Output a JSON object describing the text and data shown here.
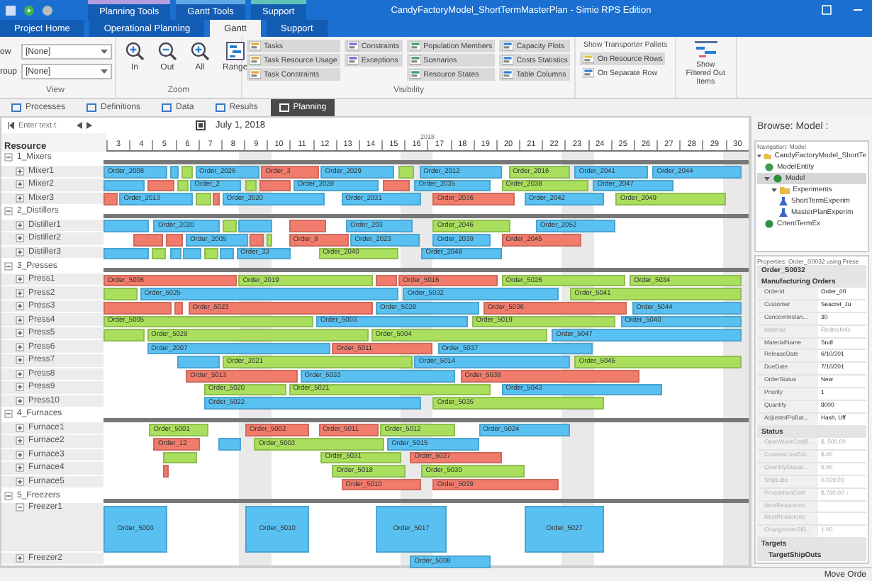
{
  "window": {
    "title": "CandyFactoryModel_ShortTermMasterPlan - Simio RPS Edition",
    "context_tabs": [
      {
        "label": "Planning Tools",
        "color": "#b59be0"
      },
      {
        "label": "Gantt Tools",
        "color": "#5fa8e6"
      },
      {
        "label": "Support",
        "color": "#62c3b8"
      }
    ]
  },
  "ribbon_tabs": [
    {
      "label": "Project Home",
      "selected": false
    },
    {
      "label": "Operational Planning",
      "selected": false
    },
    {
      "label": "Gantt",
      "selected": true
    },
    {
      "label": "Support",
      "selected": false
    }
  ],
  "view_group": {
    "label": "View",
    "fields": [
      {
        "label": "ow",
        "value": "[None]"
      },
      {
        "label": "roup",
        "value": "[None]"
      }
    ]
  },
  "zoom_group": {
    "label": "Zoom",
    "buttons": [
      {
        "label": "In",
        "kind": "in"
      },
      {
        "label": "Out",
        "kind": "out"
      },
      {
        "label": "All",
        "kind": "all"
      },
      {
        "label": "Range",
        "kind": "range"
      }
    ]
  },
  "visibility_group": {
    "label": "Visibility",
    "columns": [
      [
        {
          "label": "Tasks",
          "on": true
        },
        {
          "label": "Task Resource Usage",
          "on": true
        },
        {
          "label": "Task Constraints",
          "on": true
        }
      ],
      [
        {
          "label": "Constraints",
          "on": true
        },
        {
          "label": "Exceptions",
          "on": true
        }
      ],
      [
        {
          "label": "Population Members",
          "on": true
        },
        {
          "label": "Scenarios",
          "on": true
        },
        {
          "label": "Resource States",
          "on": true
        }
      ],
      [
        {
          "label": "Capacity Plots",
          "on": true
        },
        {
          "label": "Costs Statistics",
          "on": true
        },
        {
          "label": "Table Columns",
          "on": true
        }
      ]
    ]
  },
  "pallets": {
    "label": "Show Transporter Pallets",
    "options": [
      {
        "label": "On Resource Rows",
        "selected": true
      },
      {
        "label": "On Separate Row",
        "selected": false
      }
    ]
  },
  "filtered_button": {
    "label": "Show Filtered Out Items"
  },
  "section_tabs": [
    {
      "label": "Processes",
      "selected": false
    },
    {
      "label": "Definitions",
      "selected": false
    },
    {
      "label": "Data",
      "selected": false
    },
    {
      "label": "Results",
      "selected": false
    },
    {
      "label": "Planning",
      "selected": true
    }
  ],
  "gantt": {
    "search": {
      "placeholder": "Enter text t"
    },
    "date": "July 1, 2018",
    "year": "2018",
    "resource_header": "Resource",
    "days": [
      "3",
      "4",
      "5",
      "6",
      "7",
      "8",
      "9",
      "10",
      "11",
      "12",
      "13",
      "14",
      "15",
      "16",
      "17",
      "18",
      "19",
      "20",
      "21",
      "22",
      "23",
      "24",
      "25",
      "26",
      "27",
      "28",
      "29",
      "30"
    ],
    "rows": [
      {
        "name": "1_Mixers",
        "kind": "group",
        "expanded": true
      },
      {
        "name": "Mixer1",
        "kind": "resource",
        "expanded": false,
        "bars": [
          {
            "color": "#59c1f2",
            "label": "Order_2008"
          },
          {
            "color": "#59c1f2"
          },
          {
            "color": "#a9df5d"
          },
          {
            "color": "#59c1f2",
            "label": "Order_2026"
          },
          {
            "color": "#f27c6c",
            "label": "Order_3"
          },
          {
            "color": "#59c1f2",
            "label": "Order_2029"
          },
          {
            "color": "#a9df5d"
          },
          {
            "color": "#59c1f2",
            "label": "Order_2012"
          },
          {
            "color": "#a9df5d",
            "label": "Order_2016"
          },
          {
            "color": "#59c1f2",
            "label": "Order_2041"
          },
          {
            "color": "#59c1f2",
            "label": "Order_2044"
          }
        ]
      },
      {
        "name": "Mixer2",
        "kind": "resource",
        "expanded": false,
        "bars": [
          {
            "color": "#59c1f2"
          },
          {
            "color": "#f27c6c"
          },
          {
            "color": "#a9df5d"
          },
          {
            "color": "#59c1f2",
            "label": "Order_2"
          },
          {
            "color": "#a9df5d"
          },
          {
            "color": "#f27c6c"
          },
          {
            "color": "#59c1f2",
            "label": "Order_2028"
          },
          {
            "color": "#f27c6c"
          },
          {
            "color": "#59c1f2",
            "label": "Order_2035"
          },
          {
            "color": "#a9df5d",
            "label": "Order_2038"
          },
          {
            "color": "#59c1f2",
            "label": "Order_2047"
          }
        ]
      },
      {
        "name": "Mixer3",
        "kind": "resource",
        "expanded": false,
        "bars": [
          {
            "color": "#f27c6c"
          },
          {
            "color": "#59c1f2",
            "label": "Order_2013"
          },
          {
            "color": "#a9df5d"
          },
          {
            "color": "#f27c6c"
          },
          {
            "color": "#59c1f2",
            "label": "Order_2020"
          },
          {
            "color": "#59c1f2",
            "label": "Order_2031"
          },
          {
            "color": "#f27c6c",
            "label": "Order_2036"
          },
          {
            "color": "#59c1f2",
            "label": "Order_2042"
          },
          {
            "color": "#a9df5d",
            "label": "Order_2049"
          }
        ]
      },
      {
        "name": "2_Distillers",
        "kind": "group",
        "expanded": true
      },
      {
        "name": "Distiller1",
        "kind": "resource",
        "expanded": false,
        "bars": [
          {
            "color": "#59c1f2"
          },
          {
            "color": "#59c1f2",
            "label": "Order_2020"
          },
          {
            "color": "#a9df5d"
          },
          {
            "color": "#59c1f2"
          },
          {
            "color": "#f27c6c"
          },
          {
            "color": "#59c1f2",
            "label": "Order_203"
          },
          {
            "color": "#a9df5d",
            "label": "Order_2046"
          },
          {
            "color": "#59c1f2",
            "label": "Order_2052"
          }
        ]
      },
      {
        "name": "Distiller2",
        "kind": "resource",
        "expanded": false,
        "bars": [
          {
            "color": "#f27c6c"
          },
          {
            "color": "#f27c6c"
          },
          {
            "color": "#59c1f2",
            "label": "Order_2005"
          },
          {
            "color": "#f27c6c"
          },
          {
            "color": "#a9df5d"
          },
          {
            "color": "#f27c6c",
            "label": "Order_8"
          },
          {
            "color": "#59c1f2",
            "label": "Order_2023"
          },
          {
            "color": "#59c1f2",
            "label": "Order_2039"
          },
          {
            "color": "#f27c6c",
            "label": "Order_2045"
          }
        ]
      },
      {
        "name": "Distiller3",
        "kind": "resource",
        "expanded": false,
        "bars": [
          {
            "color": "#59c1f2"
          },
          {
            "color": "#a9df5d"
          },
          {
            "color": "#59c1f2"
          },
          {
            "color": "#59c1f2"
          },
          {
            "color": "#a9df5d"
          },
          {
            "color": "#59c1f2"
          },
          {
            "color": "#59c1f2",
            "label": "Order_33"
          },
          {
            "color": "#a9df5d",
            "label": "Order_2040"
          },
          {
            "color": "#59c1f2",
            "label": "Order_2048"
          }
        ]
      },
      {
        "name": "3_Presses",
        "kind": "group",
        "expanded": true
      },
      {
        "name": "Press1",
        "kind": "resource",
        "expanded": false,
        "bars": [
          {
            "color": "#f27c6c",
            "label": "Order_5006"
          },
          {
            "color": "#a9df5d",
            "label": "Order_2019"
          },
          {
            "color": "#f27c6c"
          },
          {
            "color": "#f27c6c",
            "label": "Order_5016"
          },
          {
            "color": "#a9df5d",
            "label": "Order_5026"
          },
          {
            "color": "#a9df5d",
            "label": "Order_5034"
          }
        ]
      },
      {
        "name": "Press2",
        "kind": "resource",
        "expanded": false,
        "bars": [
          {
            "color": "#a9df5d"
          },
          {
            "color": "#59c1f2",
            "label": "Order_5025"
          },
          {
            "color": "#59c1f2",
            "label": "Order_5032"
          },
          {
            "color": "#a9df5d",
            "label": "Order_5041"
          }
        ]
      },
      {
        "name": "Press3",
        "kind": "resource",
        "expanded": false,
        "bars": [
          {
            "color": "#f27c6c"
          },
          {
            "color": "#f27c6c"
          },
          {
            "color": "#f27c6c",
            "label": "Order_5023"
          },
          {
            "color": "#59c1f2",
            "label": "Order_5028"
          },
          {
            "color": "#f27c6c",
            "label": "Order_5036"
          },
          {
            "color": "#59c1f2",
            "label": "Order_5044"
          }
        ]
      },
      {
        "name": "Press4",
        "kind": "resource",
        "expanded": false,
        "bars": [
          {
            "color": "#a9df5d",
            "label": "Order_5005"
          },
          {
            "color": "#59c1f2",
            "label": "Order_5003"
          },
          {
            "color": "#a9df5d",
            "label": "Order_5019"
          },
          {
            "color": "#59c1f2",
            "label": "Order_5040"
          }
        ]
      },
      {
        "name": "Press5",
        "kind": "resource",
        "expanded": false,
        "bars": [
          {
            "color": "#a9df5d"
          },
          {
            "color": "#a9df5d",
            "label": "Order_5029"
          },
          {
            "color": "#a9df5d",
            "label": "Order_5004"
          },
          {
            "color": "#59c1f2",
            "label": "Order_5047"
          }
        ]
      },
      {
        "name": "Press6",
        "kind": "resource",
        "expanded": false,
        "bars": [
          {
            "color": "#59c1f2",
            "label": "Order_2007"
          },
          {
            "color": "#f27c6c",
            "label": "Order_5011"
          },
          {
            "color": "#59c1f2",
            "label": "Order_5037"
          }
        ]
      },
      {
        "name": "Press7",
        "kind": "resource",
        "expanded": false,
        "bars": [
          {
            "color": "#59c1f2"
          },
          {
            "color": "#a9df5d",
            "label": "Order_2021"
          },
          {
            "color": "#59c1f2",
            "label": "Order_5014"
          },
          {
            "color": "#a9df5d",
            "label": "Order_5045"
          }
        ]
      },
      {
        "name": "Press8",
        "kind": "resource",
        "expanded": false,
        "bars": [
          {
            "color": "#f27c6c",
            "label": "Order_5013"
          },
          {
            "color": "#59c1f2",
            "label": "Order_5033"
          },
          {
            "color": "#f27c6c",
            "label": "Order_5038"
          }
        ]
      },
      {
        "name": "Press9",
        "kind": "resource",
        "expanded": false,
        "bars": [
          {
            "color": "#a9df5d",
            "label": "Order_5020"
          },
          {
            "color": "#a9df5d",
            "label": "Order_5021"
          },
          {
            "color": "#59c1f2",
            "label": "Order_5043"
          }
        ]
      },
      {
        "name": "Press10",
        "kind": "resource",
        "expanded": false,
        "bars": [
          {
            "color": "#59c1f2",
            "label": "Order_5022"
          },
          {
            "color": "#a9df5d",
            "label": "Order_5035"
          }
        ]
      },
      {
        "name": "4_Furnaces",
        "kind": "group",
        "expanded": true
      },
      {
        "name": "Furnace1",
        "kind": "resource",
        "expanded": false,
        "bars": [
          {
            "color": "#a9df5d",
            "label": "Order_5001"
          },
          {
            "color": "#f27c6c",
            "label": "Order_5002"
          },
          {
            "color": "#f27c6c",
            "label": "Order_5011"
          },
          {
            "color": "#a9df5d",
            "label": "Order_5012"
          },
          {
            "color": "#59c1f2",
            "label": "Order_5024"
          }
        ]
      },
      {
        "name": "Furnace2",
        "kind": "resource",
        "expanded": false,
        "bars": [
          {
            "color": "#f27c6c",
            "label": "Order_12"
          },
          {
            "color": "#59c1f2"
          },
          {
            "color": "#a9df5d",
            "label": "Order_5003"
          },
          {
            "color": "#59c1f2",
            "label": "Order_5015"
          }
        ]
      },
      {
        "name": "Furnace3",
        "kind": "resource",
        "expanded": false,
        "bars": [
          {
            "color": "#a9df5d"
          },
          {
            "color": "#a9df5d",
            "label": "Order_5031"
          },
          {
            "color": "#f27c6c",
            "label": "Order_5027"
          }
        ]
      },
      {
        "name": "Furnace4",
        "kind": "resource",
        "expanded": false,
        "bars": [
          {
            "color": "#f27c6c"
          },
          {
            "color": "#a9df5d",
            "label": "Order_5018"
          },
          {
            "color": "#a9df5d",
            "label": "Order_5030"
          }
        ]
      },
      {
        "name": "Furnace5",
        "kind": "resource",
        "expanded": false,
        "bars": [
          {
            "color": "#f27c6c",
            "label": "Order_5010"
          },
          {
            "color": "#f27c6c",
            "label": "Order_5039"
          }
        ]
      },
      {
        "name": "5_Freezers",
        "kind": "group",
        "expanded": true
      },
      {
        "name": "Freezer1",
        "kind": "resource",
        "expanded": true,
        "bars": [
          {
            "color": "#59c1f2",
            "label": "Order_5003"
          },
          {
            "color": "#59c1f2",
            "label": "Order_5010"
          },
          {
            "color": "#59c1f2",
            "label": "Order_5017"
          },
          {
            "color": "#59c1f2",
            "label": "Order_5027"
          }
        ]
      },
      {
        "name": "Freezer2",
        "kind": "resource",
        "expanded": false,
        "bars": [
          {
            "color": "#59c1f2",
            "label": "Order_5008"
          }
        ]
      }
    ]
  },
  "browse": {
    "title": "Browse: Model :",
    "navigation_title": "Navigation: Model",
    "tree": [
      {
        "label": "CandyFactoryModel_ShortTe",
        "kind": "folder",
        "expanded": true,
        "children": [
          {
            "label": "ModelEntity",
            "kind": "entity"
          },
          {
            "label": "Model",
            "kind": "model",
            "selected": true,
            "expanded": true,
            "children": [
              {
                "label": "Experiments",
                "kind": "folder",
                "expanded": true,
                "children": [
                  {
                    "label": "ShortTermExperim",
                    "kind": "experiment"
                  },
                  {
                    "label": "MasterPlanExperim",
                    "kind": "experiment"
                  }
                ]
              }
            ]
          },
          {
            "label": "CrtentTermEx",
            "kind": "model"
          }
        ]
      }
    ]
  },
  "properties": {
    "title": "Properties: Order_S0032 using Prese",
    "object": "Order_S0032",
    "groups": [
      {
        "name": "Manufacturing Orders",
        "rows": [
          {
            "name": "OrderId",
            "value": "Order_00",
            "disabled": false
          },
          {
            "name": "Customer",
            "value": "Seacret_Ju",
            "disabled": false
          },
          {
            "name": "ConcernInstan...",
            "value": "30",
            "disabled": false
          },
          {
            "name": "Material",
            "value": "Redtechnic",
            "disabled": true
          },
          {
            "name": "MaterialName",
            "value": "Sndl",
            "disabled": false
          },
          {
            "name": "ReleaseDate",
            "value": "6/10/201",
            "disabled": false
          },
          {
            "name": "DueDate",
            "value": "7/10/201",
            "disabled": false
          },
          {
            "name": "OrderStatus",
            "value": "New",
            "disabled": false
          },
          {
            "name": "Priority",
            "value": "1",
            "disabled": false
          },
          {
            "name": "Quantity",
            "value": "8000",
            "disabled": false
          },
          {
            "name": "AdjustedPoBat...",
            "value": "Hash, Uff",
            "disabled": false
          }
        ]
      },
      {
        "name": "Status",
        "rows": [
          {
            "name": "OpenWorkCostB...",
            "value": "$, 500.00",
            "disabled": true
          },
          {
            "name": "CustomCostEst...",
            "value": "$.00",
            "disabled": true
          },
          {
            "name": "QuantityDispat...",
            "value": "5.00",
            "disabled": true
          },
          {
            "name": "ShipLate",
            "value": "07/29/20",
            "disabled": true
          },
          {
            "name": "ProductionCost",
            "value": "$,780.00 ↓",
            "disabled": true
          },
          {
            "name": "NextResources",
            "disabled": true
          },
          {
            "name": "NextResources",
            "disabled": true
          },
          {
            "name": "ChangeoverSIB...",
            "value": "1.00",
            "disabled": true
          }
        ]
      }
    ],
    "targets": {
      "name": "Targets",
      "subgroup": "TargetShipOuts"
    }
  },
  "status_bar": {
    "text": "Move Orde"
  }
}
